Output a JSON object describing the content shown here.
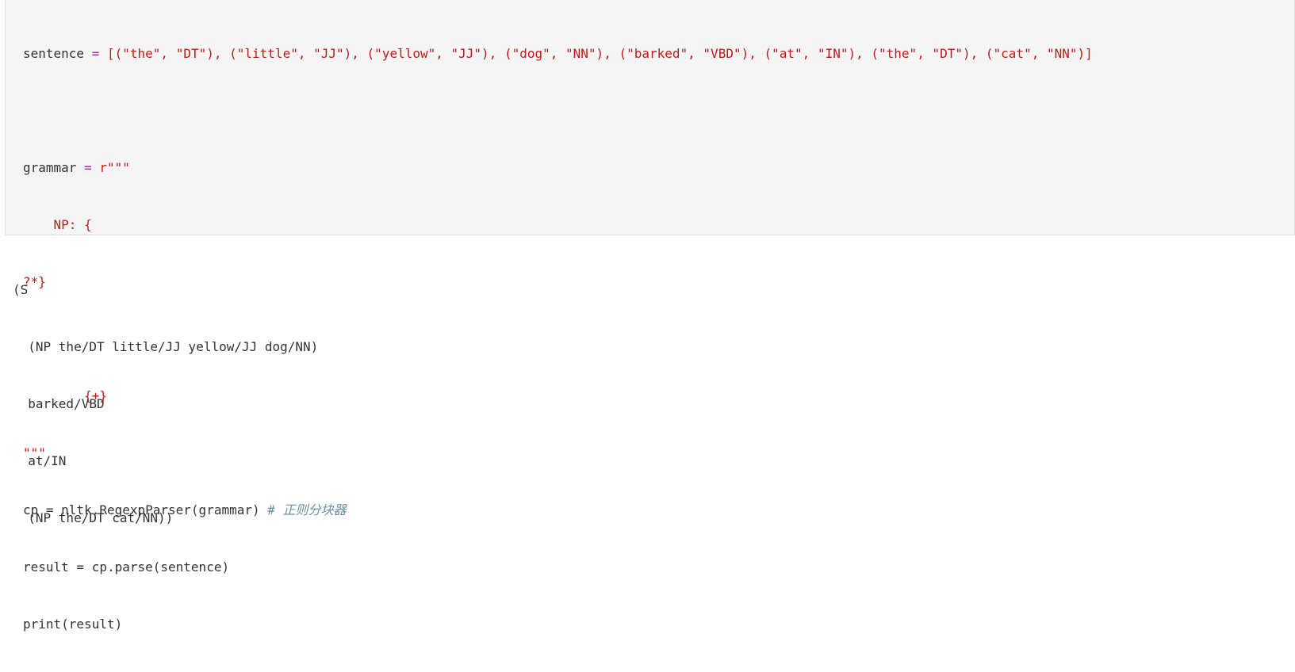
{
  "code": {
    "line1": {
      "var": "sentence",
      "eq": " = ",
      "open": "[",
      "tokens": [
        {
          "word": "\"the\"",
          "tag": "\"DT\""
        },
        {
          "word": "\"little\"",
          "tag": "\"JJ\""
        },
        {
          "word": "\"yellow\"",
          "tag": "\"JJ\""
        },
        {
          "word": "\"dog\"",
          "tag": "\"NN\""
        },
        {
          "word": "\"barked\"",
          "tag": "\"VBD\""
        },
        {
          "word": "\"at\"",
          "tag": "\"IN\""
        },
        {
          "word": "\"the\"",
          "tag": "\"DT\""
        },
        {
          "word": "\"cat\"",
          "tag": "\"NN\""
        }
      ],
      "close": "]"
    },
    "line3": {
      "var": "grammar",
      "eq": " = ",
      "str": "r\"\"\""
    },
    "line4": "    NP: {",
    "line5": "?*}",
    "line7": "        {+}",
    "line8": "\"\"\"",
    "line9": {
      "code": "cp = nltk.RegexpParser(grammar) ",
      "comment": "# 正则分块器"
    },
    "line10": "result = cp.parse(sentence)",
    "line11": "print(result)"
  },
  "output": [
    "(S",
    "  (NP the/DT little/JJ yellow/JJ dog/NN)",
    "  barked/VBD",
    "  at/IN",
    "  (NP the/DT cat/NN))"
  ]
}
